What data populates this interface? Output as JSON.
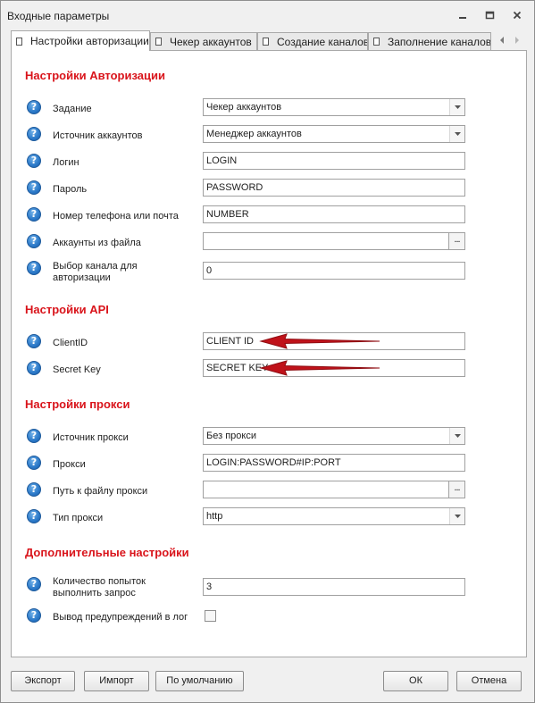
{
  "window": {
    "title": "Входные параметры"
  },
  "tabs": [
    {
      "label": "Настройки авторизации",
      "active": true
    },
    {
      "label": "Чекер аккаунтов"
    },
    {
      "label": "Создание каналов"
    },
    {
      "label": "Заполнение каналов"
    }
  ],
  "sections": {
    "auth": {
      "title": "Настройки Авторизации"
    },
    "api": {
      "title": "Настройки API"
    },
    "proxy": {
      "title": "Настройки прокси"
    },
    "extra": {
      "title": "Дополнительные настройки"
    }
  },
  "fields": {
    "task": {
      "label": "Задание",
      "value": "Чекер аккаунтов"
    },
    "accounts_source": {
      "label": "Источник аккаунтов",
      "value": "Менеджер аккаунтов"
    },
    "login": {
      "label": "Логин",
      "value": "LOGIN"
    },
    "password": {
      "label": "Пароль",
      "value": "PASSWORD"
    },
    "phone": {
      "label": "Номер телефона или почта",
      "value": "NUMBER"
    },
    "accounts_file": {
      "label": "Аккаунты из файла",
      "value": ""
    },
    "channel_choice": {
      "label_line1": "Выбор канала для",
      "label_line2": "авторизации",
      "value": "0"
    },
    "client_id": {
      "label": "ClientID",
      "value": "CLIENT ID"
    },
    "secret_key": {
      "label": "Secret Key",
      "value": "SECRET KEY"
    },
    "proxy_source": {
      "label": "Источник прокси",
      "value": "Без прокси"
    },
    "proxy": {
      "label": "Прокси",
      "value": "LOGIN:PASSWORD#IP:PORT"
    },
    "proxy_file": {
      "label": "Путь к файлу прокси",
      "value": ""
    },
    "proxy_type": {
      "label": "Тип прокси",
      "value": "http"
    },
    "retries": {
      "label_line1": "Количество попыток",
      "label_line2": "выполнить запрос",
      "value": "3"
    },
    "log_warnings": {
      "label": "Вывод предупреждений в лог",
      "checked": false
    }
  },
  "buttons": {
    "export": "Экспорт",
    "import": "Импорт",
    "default": "По умолчанию",
    "ok": "ОК",
    "cancel": "Отмена"
  },
  "icons": {
    "help": "?",
    "browse": "...",
    "minimize": "minimize-icon",
    "restore": "restore-icon",
    "close": "close-icon"
  },
  "colors": {
    "section_title": "#d9141b",
    "annotation_arrow": "#c0121a",
    "help_icon": "#2a78c8"
  }
}
